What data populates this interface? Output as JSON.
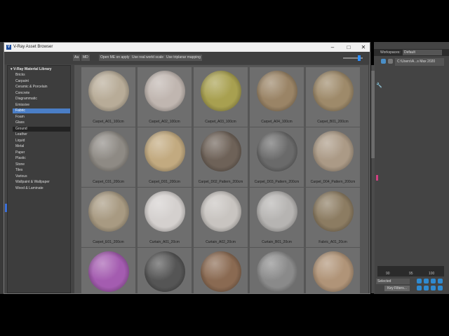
{
  "window": {
    "title": "V-Ray Asset Browser",
    "icon_letter": "V",
    "minimize_glyph": "–",
    "maximize_glyph": "□",
    "close_glyph": "✕"
  },
  "toolbar": {
    "btn_aa": "Aa",
    "btn_md": "MD",
    "btn_open_me": "Open ME on apply",
    "btn_real_world": "Use real world scale",
    "btn_triplanar": "Use triplanar mapping"
  },
  "sidebar": {
    "library_title": "▾ V-Ray Material Library",
    "categories": [
      "Bricks",
      "Carpaint",
      "Ceramic & Porcelain",
      "Concrete",
      "Diagrammatic",
      "Emissive",
      "Fabric",
      "Foam",
      "Glass",
      "Ground",
      "Leather",
      "Liquid",
      "Metal",
      "Paper",
      "Plastic",
      "Stone",
      "Tiles",
      "Various",
      "Wallpaint & Wallpaper",
      "Wood & Laminate"
    ],
    "selected": "Fabric",
    "hovered": "Ground"
  },
  "materials": [
    {
      "name": "Carpet_A01_100cm",
      "color": "#b8ac98"
    },
    {
      "name": "Carpet_A02_100cm",
      "color": "#c0b6b0"
    },
    {
      "name": "Carpet_A03_100cm",
      "color": "#a8a050"
    },
    {
      "name": "Carpet_A04_100cm",
      "color": "#9a8466"
    },
    {
      "name": "Carpet_B01_200cm",
      "color": "#9e8a6a"
    },
    {
      "name": "Carpet_C01_200cm",
      "color": "#8e8a84"
    },
    {
      "name": "Carpet_D01_200cm",
      "color": "#c2aa80"
    },
    {
      "name": "Carpet_D02_Pattern_200cm",
      "color": "#6e6258"
    },
    {
      "name": "Carpet_D03_Pattern_200cm",
      "color": "#6a6a6a"
    },
    {
      "name": "Carpet_D04_Pattern_200cm",
      "color": "#ab9a86"
    },
    {
      "name": "Carpet_E01_200cm",
      "color": "#a89a82"
    },
    {
      "name": "Curtain_A01_20cm",
      "color": "#d4d0ce"
    },
    {
      "name": "Curtain_A02_20cm",
      "color": "#c8c4c0"
    },
    {
      "name": "Curtain_B01_20cm",
      "color": "#b6b4b2"
    },
    {
      "name": "Fabric_A01_20cm",
      "color": "#8c7c62"
    },
    {
      "name": "",
      "color": "#a45cb0"
    },
    {
      "name": "",
      "color": "#555555"
    },
    {
      "name": "",
      "color": "#8a6a52"
    },
    {
      "name": "",
      "color": "#8a8a8a"
    },
    {
      "name": "",
      "color": "#b09478"
    }
  ],
  "max_ui": {
    "workspaces_label": "Workspaces:",
    "workspaces_value": "Default",
    "path_value": "C:\\Users\\A...s Max 2020",
    "ruler_ticks": [
      "90",
      "95",
      "100"
    ],
    "selection_value": "Selected",
    "filters_label": "Key Filters..."
  }
}
